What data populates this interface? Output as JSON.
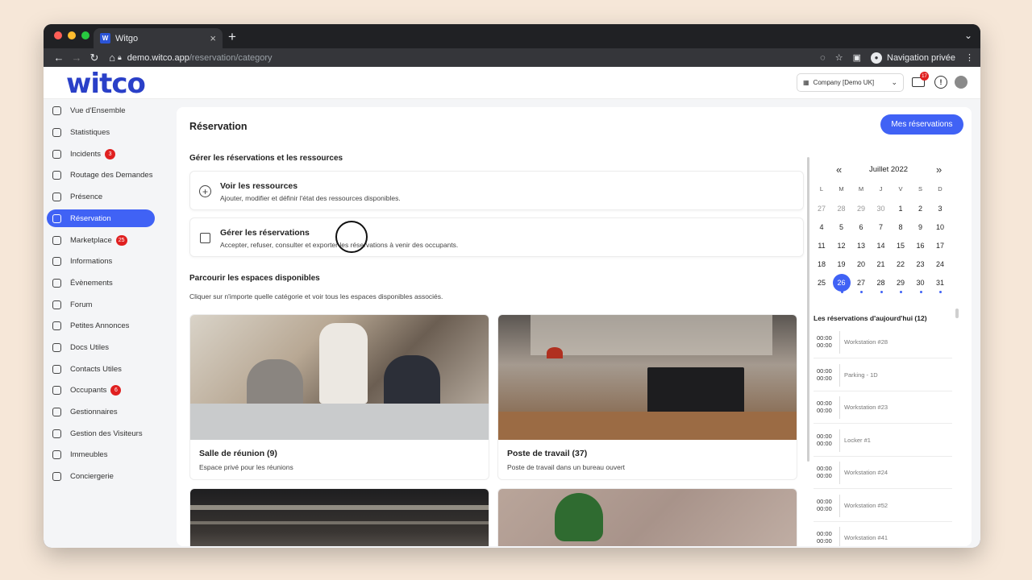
{
  "browser": {
    "tab_title": "Witgo",
    "tab_icon": "W",
    "url_host": "demo.witco.app",
    "url_path": "/reservation/category",
    "profile_label": "Navigation privée"
  },
  "header": {
    "logo": "witco",
    "company": "Company [Demo UK]",
    "mail_badge": "17"
  },
  "sidebar": {
    "items": [
      {
        "label": "Vue d'Ensemble",
        "badge": null
      },
      {
        "label": "Statistiques",
        "badge": null
      },
      {
        "label": "Incidents",
        "badge": "3"
      },
      {
        "label": "Routage des Demandes",
        "badge": null
      },
      {
        "label": "Présence",
        "badge": null
      },
      {
        "label": "Réservation",
        "badge": null
      },
      {
        "label": "Marketplace",
        "badge": "25"
      },
      {
        "label": "Informations",
        "badge": null
      },
      {
        "label": "Évènements",
        "badge": null
      },
      {
        "label": "Forum",
        "badge": null
      },
      {
        "label": "Petites Annonces",
        "badge": null
      },
      {
        "label": "Docs Utiles",
        "badge": null
      },
      {
        "label": "Contacts Utiles",
        "badge": null
      },
      {
        "label": "Occupants",
        "badge": "6"
      },
      {
        "label": "Gestionnaires",
        "badge": null
      },
      {
        "label": "Gestion des Visiteurs",
        "badge": null
      },
      {
        "label": "Immeubles",
        "badge": null
      },
      {
        "label": "Conciergerie",
        "badge": null
      }
    ]
  },
  "main": {
    "title": "Réservation",
    "my_reservations_button": "Mes réservations",
    "manage_section_title": "Gérer les réservations et les ressources",
    "actions": [
      {
        "title": "Voir les ressources",
        "desc": "Ajouter, modifier et définir l'état des ressources disponibles."
      },
      {
        "title": "Gérer les réservations",
        "desc": "Accepter, refuser, consulter et exporter les réservations à venir des occupants."
      }
    ],
    "browse_title": "Parcourir les espaces disponibles",
    "browse_subtitle": "Cliquer sur n'importe quelle catégorie et voir tous les espaces disponibles associés.",
    "spaces": [
      {
        "title": "Salle de réunion (9)",
        "desc": "Espace privé pour les réunions"
      },
      {
        "title": "Poste de travail (37)",
        "desc": "Poste de travail dans un bureau ouvert"
      }
    ]
  },
  "calendar": {
    "month": "Juillet 2022",
    "prev": "«",
    "next": "»",
    "weekdays": [
      "L",
      "M",
      "M",
      "J",
      "V",
      "S",
      "D"
    ],
    "weeks": [
      [
        "27",
        "28",
        "29",
        "30",
        "1",
        "2",
        "3"
      ],
      [
        "4",
        "5",
        "6",
        "7",
        "8",
        "9",
        "10"
      ],
      [
        "11",
        "12",
        "13",
        "14",
        "15",
        "16",
        "17"
      ],
      [
        "18",
        "19",
        "20",
        "21",
        "22",
        "23",
        "24"
      ],
      [
        "25",
        "26",
        "27",
        "28",
        "29",
        "30",
        "31"
      ]
    ],
    "selected_day": "26"
  },
  "today": {
    "title": "Les réservations d'aujourd'hui (12)",
    "items": [
      {
        "start": "00:00",
        "end": "00:00",
        "name": "Workstation #28"
      },
      {
        "start": "00:00",
        "end": "00:00",
        "name": "Parking - 1D"
      },
      {
        "start": "00:00",
        "end": "00:00",
        "name": "Workstation #23"
      },
      {
        "start": "00:00",
        "end": "00:00",
        "name": "Locker #1"
      },
      {
        "start": "00:00",
        "end": "00:00",
        "name": "Workstation #24"
      },
      {
        "start": "00:00",
        "end": "00:00",
        "name": "Workstation #52"
      },
      {
        "start": "00:00",
        "end": "00:00",
        "name": "Workstation #41"
      }
    ]
  },
  "help_label": "?"
}
